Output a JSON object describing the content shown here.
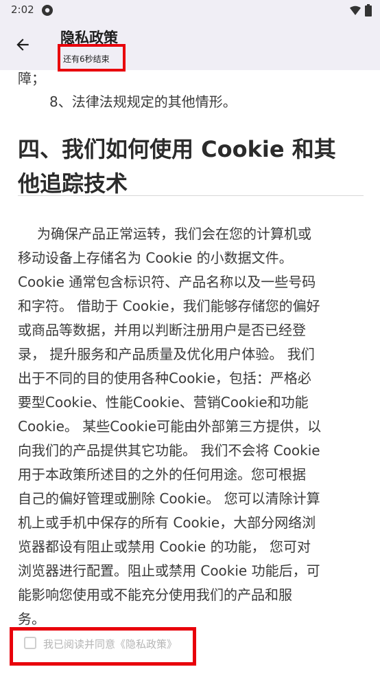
{
  "status_bar": {
    "time": "2:02",
    "icons": [
      "settings-sync-icon",
      "wifi-icon",
      "battery-icon"
    ]
  },
  "app_bar": {
    "title": "隐私政策",
    "countdown": "还有6秒结束"
  },
  "content": {
    "lines_top": [
      "障；",
      "8、法律法规规定的其他情形。"
    ],
    "heading_lines": [
      "四、我们如何使用 Cookie 和其",
      "他追踪技术"
    ],
    "paragraph_lines": [
      "为确保产品正常运转，我们会在您的计算机或",
      "移动设备上存储名为 Cookie 的小数据文件。",
      "Cookie 通常包含标识符、产品名称以及一些号码",
      "和字符。 借助于 Cookie，我们能够存储您的偏好",
      "或商品等数据，并用以判断注册用户是否已经登",
      "录， 提升服务和产品质量及优化用户体验。 我们",
      "出于不同的目的使用各种Cookie，包括：严格必",
      "要型Cookie、性能Cookie、营销Cookie和功能",
      "Cookie。 某些Cookie可能由外部第三方提供，以",
      "向我们的产品提供其它功能。 我们不会将 Cookie",
      "用于本政策所述目的之外的任何用途。您可根据",
      "自己的偏好管理或删除 Cookie。 您可以清除计算",
      "机上或手机中保存的所有 Cookie，大部分网络浏",
      "览器都设有阻止或禁用 Cookie 的功能， 您可对",
      "浏览器进行配置。阻止或禁用 Cookie 功能后，可",
      "能影响您使用或不能充分使用我们的产品和服",
      "务。"
    ]
  },
  "agreement": {
    "label": "我已阅读并同意《隐私政策》",
    "checked": false
  },
  "colors": {
    "bar_background": "#f0eef5",
    "highlight_red": "#e8000b",
    "body_text": "#3a3a3a"
  }
}
